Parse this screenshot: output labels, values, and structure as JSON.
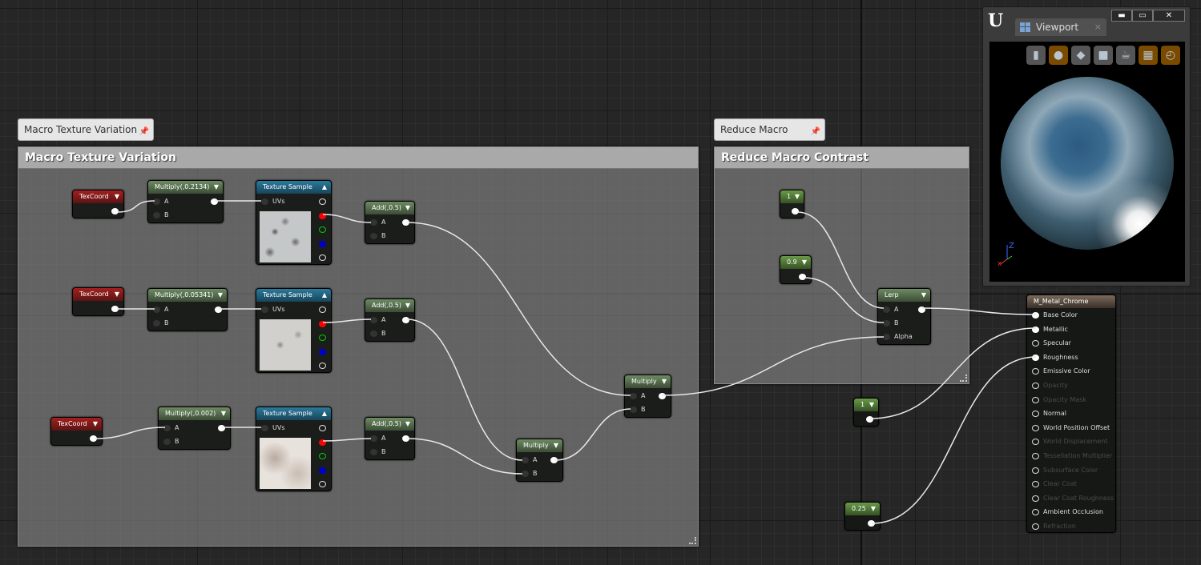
{
  "comments": [
    {
      "id": "c1",
      "title": "Macro Texture Variation",
      "bubble": "Macro Texture Variation"
    },
    {
      "id": "c2",
      "title": "Reduce Macro Contrast",
      "bubble": "Reduce Macro Contrast"
    }
  ],
  "nodes": [
    {
      "id": "tc1",
      "type": "red",
      "title": "TexCoord",
      "inputs": [],
      "outputs": [
        "on"
      ]
    },
    {
      "id": "mul1",
      "type": "green",
      "title": "Multiply(,0.2134)",
      "inputs": [
        "A",
        "B"
      ],
      "outputs": [
        "on"
      ]
    },
    {
      "id": "ts1",
      "type": "tex",
      "title": "Texture Sample",
      "inputs": [
        "UVs"
      ],
      "texture": "noise-a"
    },
    {
      "id": "add1",
      "type": "green",
      "title": "Add(,0.5)",
      "inputs": [
        "A",
        "B"
      ],
      "outputs": [
        "on"
      ]
    },
    {
      "id": "tc2",
      "type": "red",
      "title": "TexCoord",
      "inputs": [],
      "outputs": [
        "on"
      ]
    },
    {
      "id": "mul2",
      "type": "green",
      "title": "Multiply(,0.05341)",
      "inputs": [
        "A",
        "B"
      ],
      "outputs": [
        "on"
      ]
    },
    {
      "id": "ts2",
      "type": "tex",
      "title": "Texture Sample",
      "inputs": [
        "UVs"
      ],
      "texture": "noise-b"
    },
    {
      "id": "add2",
      "type": "green",
      "title": "Add(,0.5)",
      "inputs": [
        "A",
        "B"
      ],
      "outputs": [
        "on"
      ]
    },
    {
      "id": "tc3",
      "type": "red",
      "title": "TexCoord",
      "inputs": [],
      "outputs": [
        "on"
      ]
    },
    {
      "id": "mul3",
      "type": "green",
      "title": "Multiply(,0.002)",
      "inputs": [
        "A",
        "B"
      ],
      "outputs": [
        "on"
      ]
    },
    {
      "id": "ts3",
      "type": "tex",
      "title": "Texture Sample",
      "inputs": [
        "UVs"
      ],
      "texture": "blur"
    },
    {
      "id": "add3",
      "type": "green",
      "title": "Add(,0.5)",
      "inputs": [
        "A",
        "B"
      ],
      "outputs": [
        "on"
      ]
    },
    {
      "id": "mulA",
      "type": "green",
      "title": "Multiply",
      "inputs": [
        "A",
        "B"
      ],
      "outputs": [
        "on"
      ]
    },
    {
      "id": "mulB",
      "type": "green",
      "title": "Multiply",
      "inputs": [
        "A",
        "B"
      ],
      "outputs": [
        "on"
      ]
    },
    {
      "id": "k1",
      "type": "const",
      "title": "1",
      "inputs": [],
      "outputs": [
        "on"
      ]
    },
    {
      "id": "k09",
      "type": "const",
      "title": "0.9",
      "inputs": [],
      "outputs": [
        "on"
      ]
    },
    {
      "id": "lerp",
      "type": "green",
      "title": "Lerp",
      "inputs": [
        "A",
        "B",
        "Alpha"
      ],
      "outputs": [
        "on"
      ]
    },
    {
      "id": "k1b",
      "type": "const",
      "title": "1",
      "inputs": [],
      "outputs": [
        "on"
      ]
    },
    {
      "id": "k025",
      "type": "const",
      "title": "0.25",
      "inputs": [],
      "outputs": [
        "on"
      ]
    }
  ],
  "material": {
    "title": "M_Metal_Chrome",
    "pins": [
      {
        "label": "Base Color",
        "state": "connected"
      },
      {
        "label": "Metallic",
        "state": "connected"
      },
      {
        "label": "Specular",
        "state": "enabled"
      },
      {
        "label": "Roughness",
        "state": "connected"
      },
      {
        "label": "Emissive Color",
        "state": "enabled"
      },
      {
        "label": "Opacity",
        "state": "disabled"
      },
      {
        "label": "Opacity Mask",
        "state": "disabled"
      },
      {
        "label": "Normal",
        "state": "enabled"
      },
      {
        "label": "World Position Offset",
        "state": "enabled"
      },
      {
        "label": "World Displacement",
        "state": "disabled"
      },
      {
        "label": "Tessellation Multiplier",
        "state": "disabled"
      },
      {
        "label": "Subsurface Color",
        "state": "disabled"
      },
      {
        "label": "Clear Coat",
        "state": "disabled"
      },
      {
        "label": "Clear Coat Roughness",
        "state": "disabled"
      },
      {
        "label": "Ambient Occlusion",
        "state": "enabled"
      },
      {
        "label": "Refraction",
        "state": "disabled"
      }
    ]
  },
  "viewport": {
    "tab": "Viewport",
    "logo": "U",
    "buttons": [
      "cylinder",
      "sphere",
      "plane",
      "cube",
      "teapot",
      "grid",
      "realtime"
    ],
    "active": [
      "sphere",
      "grid",
      "realtime"
    ]
  },
  "colors": {
    "texcoord": "#a3201f",
    "math": "#6d8b62",
    "texture": "#2a7a9c",
    "constant": "#6a9a4a",
    "comment": "#a9a9a9"
  }
}
